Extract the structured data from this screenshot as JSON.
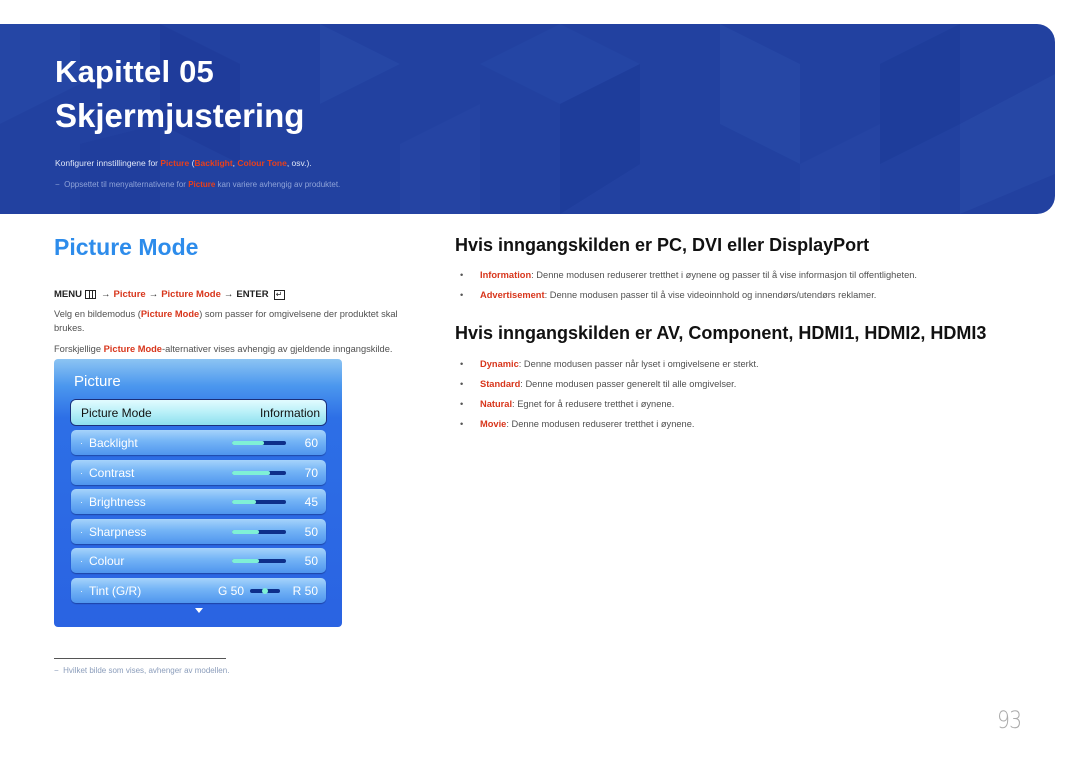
{
  "banner": {
    "chapter": "Kapittel 05",
    "title": "Skjermjustering",
    "description": {
      "prefix": "Konfigurer innstillingene for ",
      "picture": "Picture",
      "open": " (",
      "backlight": "Backlight",
      "comma": ", ",
      "colour_tone": "Colour Tone",
      "suffix": ", osv.)."
    },
    "note": {
      "dash": "−",
      "prefix": "Oppsettet til menyalternativene for ",
      "picture": "Picture",
      "suffix": " kan variere avhengig av produktet."
    }
  },
  "section": {
    "title": "Picture Mode",
    "menu_path": {
      "menu": "MENU",
      "arrow": "→",
      "picture": "Picture",
      "picture_mode": "Picture Mode",
      "enter": "ENTER",
      "enter_glyph": "↵"
    },
    "para1": {
      "prefix": "Velg en bildemodus (",
      "hl": "Picture Mode",
      "suffix": ") som passer for omgivelsene der produktet skal brukes."
    },
    "para2": {
      "prefix": "Forskjellige ",
      "hl": "Picture Mode",
      "suffix": "-alternativer vises avhengig av gjeldende inngangskilde."
    }
  },
  "osd": {
    "title": "Picture",
    "selected": {
      "label": "Picture Mode",
      "value": "Information"
    },
    "bullet": "·",
    "items": [
      {
        "label": "Backlight",
        "value": "60",
        "level": 0.6
      },
      {
        "label": "Contrast",
        "value": "70",
        "level": 0.7
      },
      {
        "label": "Brightness",
        "value": "45",
        "level": 0.45
      },
      {
        "label": "Sharpness",
        "value": "50",
        "level": 0.5
      },
      {
        "label": "Colour",
        "value": "50",
        "level": 0.5
      }
    ],
    "tint": {
      "label": "Tint (G/R)",
      "g": "G 50",
      "r": "R 50",
      "level": 0.5
    }
  },
  "right": {
    "heading1": "Hvis inngangskilden er PC, DVI eller DisplayPort",
    "list1": [
      {
        "term": "Information",
        "text": ": Denne modusen reduserer tretthet i øynene og passer til å vise informasjon til offentligheten."
      },
      {
        "term": "Advertisement",
        "text": ": Denne modusen passer til å vise videoinnhold og innendørs/utendørs reklamer."
      }
    ],
    "heading2": "Hvis inngangskilden er AV, Component, HDMI1, HDMI2, HDMI3",
    "list2": [
      {
        "term": "Dynamic",
        "text": ": Denne modusen passer når lyset i omgivelsene er sterkt."
      },
      {
        "term": "Standard",
        "text": ": Denne modusen passer generelt til alle omgivelser."
      },
      {
        "term": "Natural",
        "text": ": Egnet for å redusere tretthet i øynene."
      },
      {
        "term": "Movie",
        "text": ": Denne modusen reduserer tretthet i øynene."
      }
    ],
    "bullet": "•"
  },
  "footnote": {
    "dash": "−",
    "text": "Hvilket bilde som vises, avhenger av modellen."
  },
  "page_number": "93",
  "colors": {
    "banner": "#2241a0",
    "accent_blue": "#2d8ceb",
    "highlight_red": "#d8361c"
  }
}
